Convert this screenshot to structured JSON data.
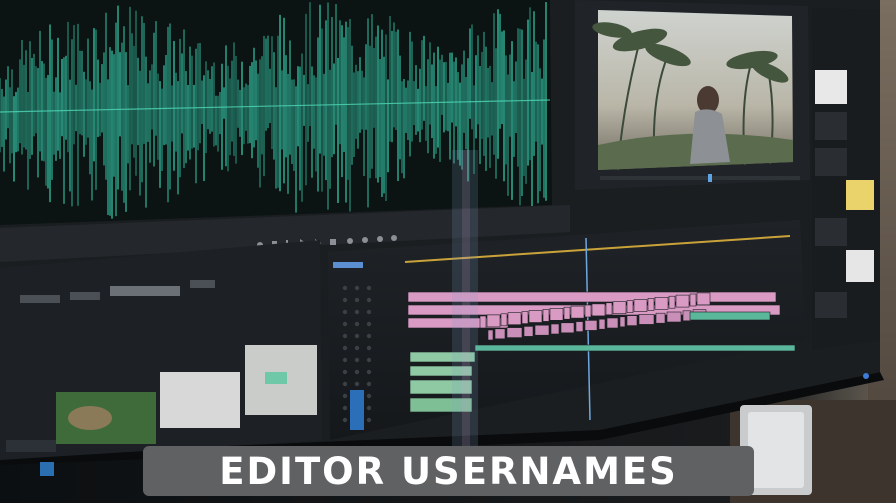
{
  "banner": {
    "title": "EDITOR USERNAMES"
  },
  "colors": {
    "waveform": "#2ea98f",
    "timeline_pink": "#d99ac4",
    "timeline_green": "#8fc9a3",
    "banner_bg": "#5f6163",
    "banner_text": "#ffffff"
  }
}
